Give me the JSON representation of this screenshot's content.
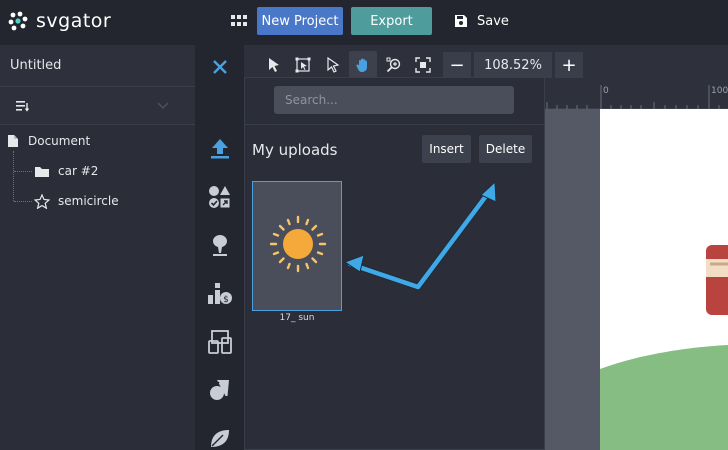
{
  "app": {
    "logo_text": "svgator",
    "new_project_label": "New Project",
    "export_label": "Export",
    "save_label": "Save"
  },
  "document": {
    "title": "Untitled",
    "tree": [
      {
        "label": "Document",
        "icon": "file-icon"
      },
      {
        "label": "car #2",
        "icon": "folder-icon"
      },
      {
        "label": "semicircle",
        "icon": "star-icon"
      }
    ]
  },
  "toolbar": {
    "zoom_value": "108.52%",
    "zoom_minus": "−",
    "zoom_plus": "+"
  },
  "ruler": {
    "labels": [
      "0",
      "100"
    ]
  },
  "drawer": {
    "search_placeholder": "Search...",
    "title": "My uploads",
    "insert_label": "Insert",
    "delete_label": "Delete",
    "uploads": [
      {
        "label": "17_ sun"
      }
    ],
    "rail_icons": [
      "upload-icon",
      "shapes-icon",
      "tree-icon",
      "finance-icon",
      "devices-icon",
      "food-icon",
      "leaf-icon"
    ]
  },
  "colors": {
    "accent_blue": "#4a78c8",
    "export_teal": "#4e9c9c",
    "annotation_arrow": "#3fa9e8",
    "sun": "#f6a93b"
  }
}
